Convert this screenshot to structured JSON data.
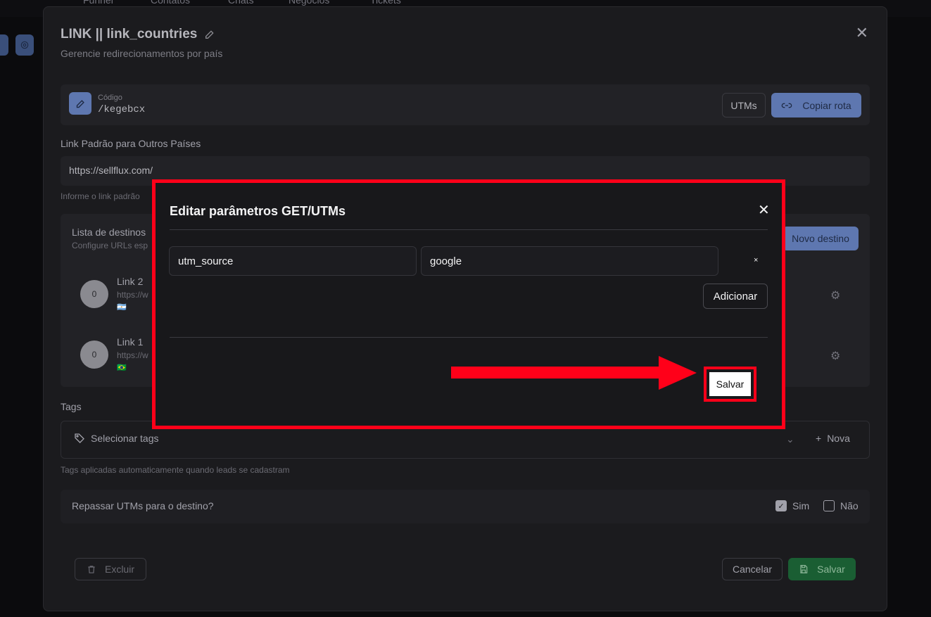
{
  "topnav": {
    "tabs": [
      "Funnel",
      "Contatos",
      "Chats",
      "Negócios",
      "Tickets"
    ]
  },
  "modal": {
    "title": "LINK || link_countries",
    "subtitle": "Gerencie redirecionamentos por país",
    "code": {
      "label": "Código",
      "value": "/kegebcx"
    },
    "utms_button": "UTMs",
    "copy_button": "Copiar rota",
    "default_link": {
      "label": "Link Padrão para Outros Países",
      "value": "https://sellflux.com/",
      "help": "Informe o link padrão"
    },
    "destinations": {
      "title": "Lista de destinos",
      "subtitle": "Configure URLs esp",
      "new_button": "Novo destino",
      "items": [
        {
          "avatar": "0",
          "name": "Link 2",
          "url": "https://w",
          "flag": "🇦🇷"
        },
        {
          "avatar": "0",
          "name": "Link 1",
          "url": "https://w",
          "flag": "🇧🇷"
        }
      ]
    },
    "tags": {
      "label": "Tags",
      "placeholder": "Selecionar tags",
      "new": "Nova",
      "help": "Tags aplicadas automaticamente quando leads se cadastram"
    },
    "utm_forward": {
      "question": "Repassar UTMs para o destino?",
      "yes": "Sim",
      "no": "Não",
      "selected": "yes"
    },
    "footer": {
      "delete": "Excluir",
      "cancel": "Cancelar",
      "save": "Salvar"
    }
  },
  "dialog": {
    "title": "Editar parâmetros GET/UTMs",
    "params": [
      {
        "key": "utm_source",
        "value": "google"
      }
    ],
    "remove_glyph": "×",
    "add_button": "Adicionar",
    "save_button": "Salvar"
  },
  "colors": {
    "highlight": "#ff0019",
    "accent": "#5e77b0",
    "success": "#1a5e33"
  }
}
